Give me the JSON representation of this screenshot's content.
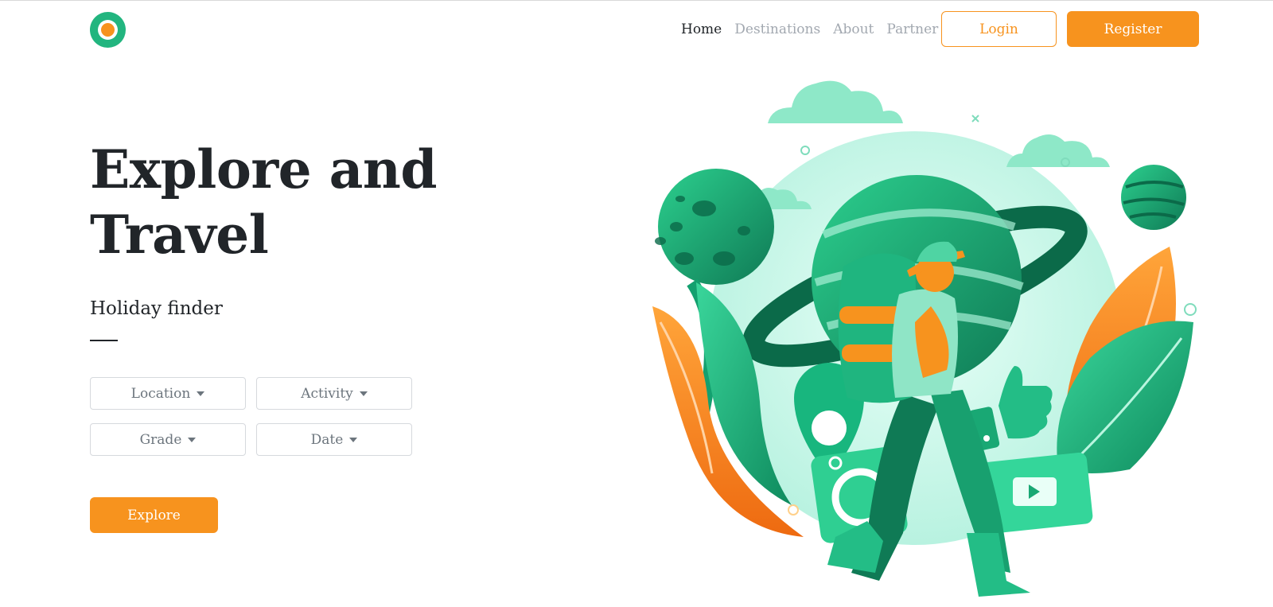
{
  "header": {
    "logo_icon": "circle-logo-icon",
    "nav": [
      {
        "label": "Home",
        "active": true
      },
      {
        "label": "Destinations",
        "active": false
      },
      {
        "label": "About",
        "active": false
      },
      {
        "label": "Partner",
        "active": false
      }
    ],
    "login_label": "Login",
    "register_label": "Register"
  },
  "hero": {
    "title_line1": "Explore and",
    "title_line2": "Travel",
    "subtitle": "Holiday finder",
    "filters": [
      {
        "label": "Location"
      },
      {
        "label": "Activity"
      },
      {
        "label": "Grade"
      },
      {
        "label": "Date"
      }
    ],
    "explore_label": "Explore"
  },
  "colors": {
    "accent": "#f7931e",
    "brand_green": "#22b57f",
    "text_dark": "#212529",
    "nav_muted": "#a2a8b0"
  }
}
